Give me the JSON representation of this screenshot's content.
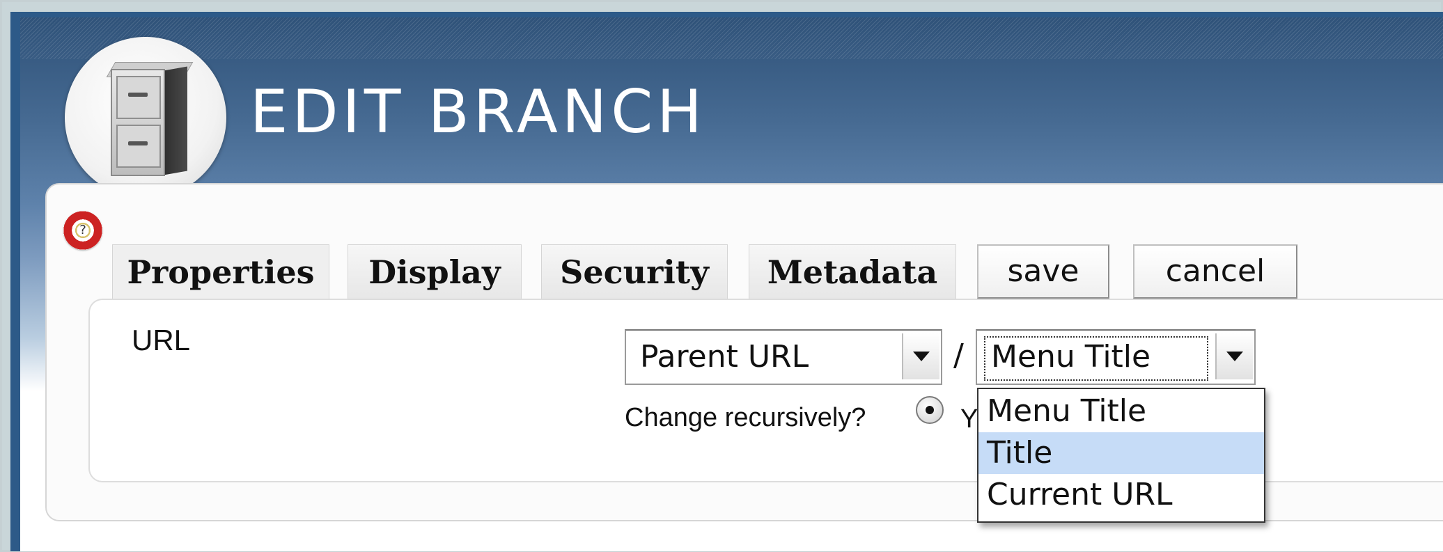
{
  "header": {
    "title": "EDIT BRANCH"
  },
  "tabs": [
    {
      "label": "Properties"
    },
    {
      "label": "Display"
    },
    {
      "label": "Security"
    },
    {
      "label": "Metadata"
    }
  ],
  "actions": {
    "save_label": "save",
    "cancel_label": "cancel"
  },
  "form": {
    "url_label": "URL",
    "parent_select_value": "Parent URL",
    "separator": "/",
    "title_select_value": "Menu Title",
    "recursive_label": "Change recursively?",
    "radio_label_visible": "Y"
  },
  "dropdown": {
    "options": [
      {
        "label": "Menu Title"
      },
      {
        "label": "Title"
      },
      {
        "label": "Current URL"
      }
    ],
    "highlighted_index": 1
  },
  "colors": {
    "header_blue": "#2d5a88",
    "highlight": "#c6dcf7"
  },
  "icons": {
    "logo": "file-cabinet-icon",
    "help": "help-lifebuoy-icon"
  }
}
